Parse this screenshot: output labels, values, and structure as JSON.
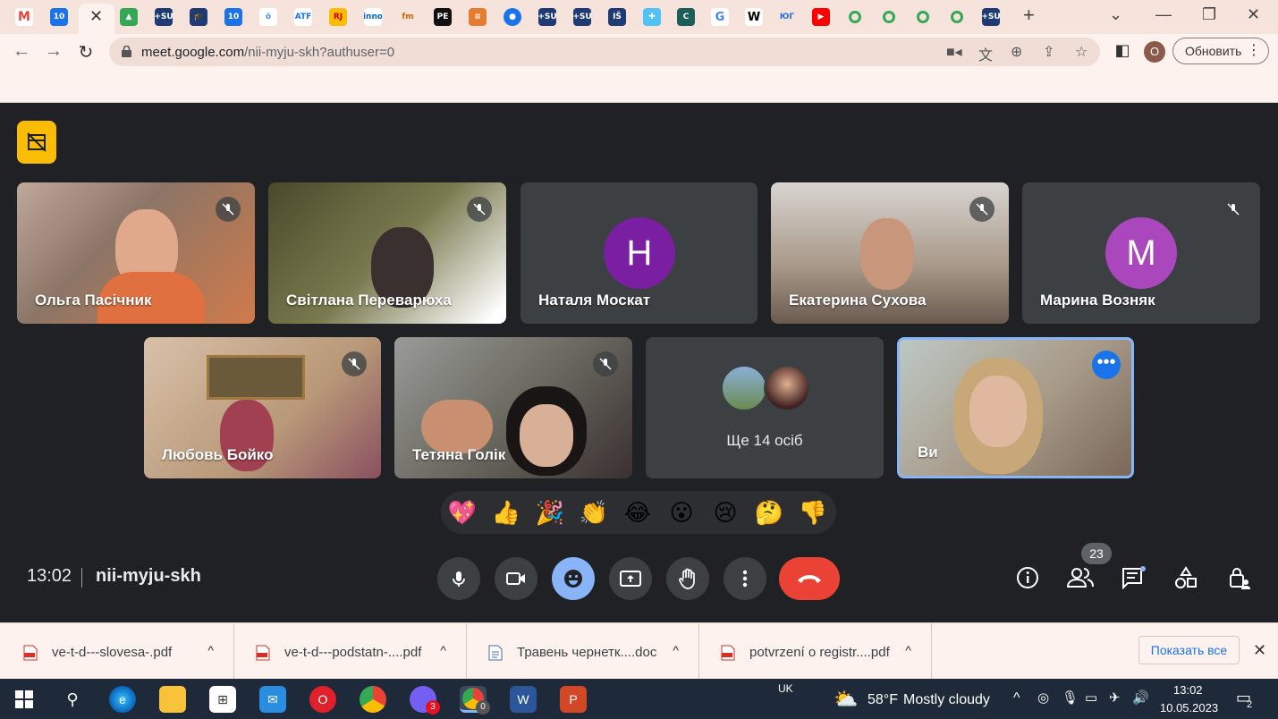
{
  "browser": {
    "url_host": "meet.google.com",
    "url_path": "/nii-myju-skh?authuser=0",
    "profile_initial": "O",
    "update_label": "Обновить",
    "tab_favicons": [
      "gmail",
      "10",
      "active",
      "drive",
      "+SU",
      "cap",
      "10",
      "ling",
      "ATF",
      "RJ",
      "inno",
      "fm",
      "PE",
      "stack",
      "chat",
      "+SU",
      "+SU",
      "IŠ",
      "puzzle",
      "C",
      "G",
      "W",
      "ЮГ",
      "youtube",
      "green",
      "green",
      "green",
      "green",
      "+SU"
    ]
  },
  "meet": {
    "participants_row1": [
      {
        "name": "Ольга Пасічник",
        "kind": "video",
        "muted": true
      },
      {
        "name": "Світлана Переварюха",
        "kind": "video",
        "muted": true
      },
      {
        "name": "Наталя Москат",
        "kind": "avatar",
        "initial": "Н",
        "color": "#7b1fa2",
        "muted": false
      },
      {
        "name": "Екатерина Сухова",
        "kind": "video",
        "muted": true
      },
      {
        "name": "Марина Возняк",
        "kind": "avatar",
        "initial": "М",
        "color": "#ab47bc",
        "muted": true
      }
    ],
    "participants_row2": [
      {
        "name": "Любовь Бойко",
        "kind": "video",
        "muted": true
      },
      {
        "name": "Тетяна Голік",
        "kind": "video",
        "muted": true
      }
    ],
    "more_people_label": "Ще 14 осіб",
    "self_name": "Ви",
    "reactions": [
      "💖",
      "👍",
      "🎉",
      "👏",
      "😂",
      "😮",
      "😢",
      "🤔",
      "👎"
    ],
    "time": "13:02",
    "meeting_code": "nii-myju-skh",
    "participant_count": "23"
  },
  "downloads": {
    "items": [
      {
        "name": "ve-t-d---slovesa-.pdf",
        "type": "pdf"
      },
      {
        "name": "ve-t-d---podstatn-....pdf",
        "type": "pdf"
      },
      {
        "name": "Травень чернетк....doc",
        "type": "doc"
      },
      {
        "name": "potvrzení o registr....pdf",
        "type": "pdf"
      }
    ],
    "show_all_label": "Показать все"
  },
  "taskbar": {
    "language": "UK",
    "weather_temp": "58°F",
    "weather_text": "Mostly cloudy",
    "clock_time": "13:02",
    "clock_date": "10.05.2023",
    "viber_badge": "3",
    "chrome_badge": "0",
    "notif_count": "2"
  }
}
